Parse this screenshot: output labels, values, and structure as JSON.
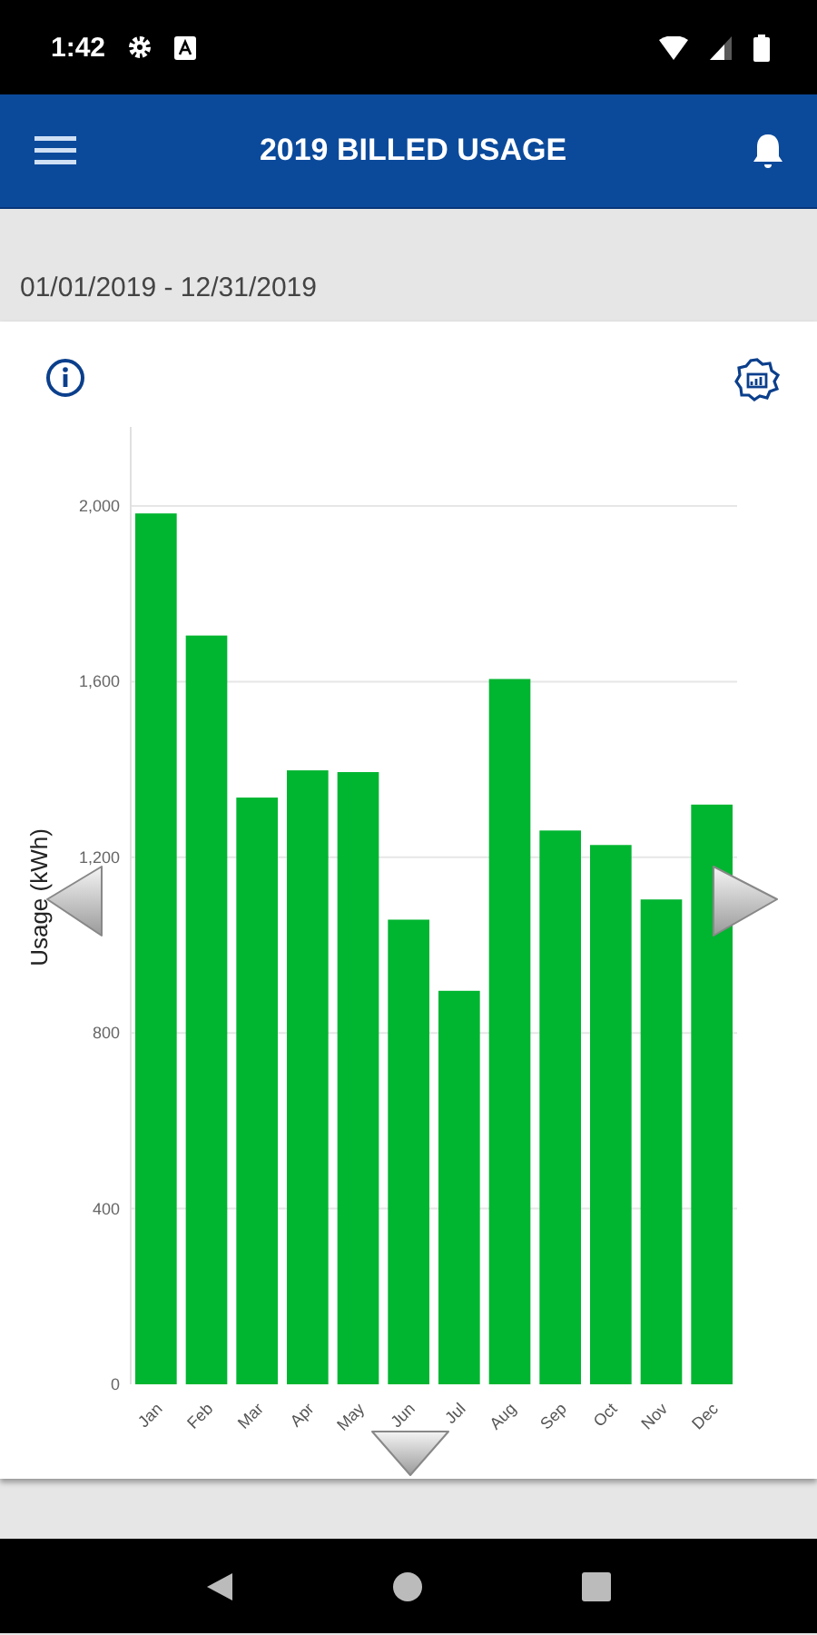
{
  "status_bar": {
    "time": "1:42"
  },
  "header": {
    "title": "2019 BILLED USAGE"
  },
  "date_range": "01/01/2019 - 12/31/2019",
  "chart_data": {
    "type": "bar",
    "grid": true,
    "ylabel": "Usage (kWh)",
    "color": "#00b530",
    "categories": [
      "Jan",
      "Feb",
      "Mar",
      "Apr",
      "May",
      "Jun",
      "Jul",
      "Aug",
      "Sep",
      "Oct",
      "Nov",
      "Dec"
    ],
    "values": [
      1983,
      1705,
      1336,
      1398,
      1394,
      1058,
      896,
      1606,
      1261,
      1228,
      1104,
      1320
    ],
    "ylim": [
      0,
      2180
    ],
    "yticks": [
      {
        "value": 0,
        "label": "0"
      },
      {
        "value": 400,
        "label": "400"
      },
      {
        "value": 800,
        "label": "800"
      },
      {
        "value": 1200,
        "label": "1,200"
      },
      {
        "value": 1600,
        "label": "1,600"
      },
      {
        "value": 2000,
        "label": "2,000"
      }
    ]
  }
}
